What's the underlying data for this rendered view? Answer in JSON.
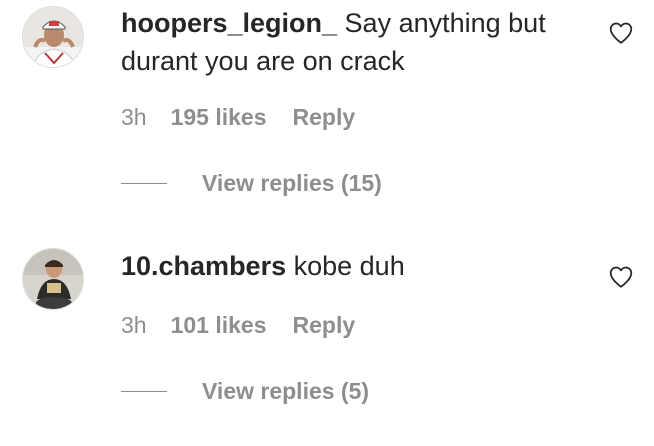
{
  "comments": [
    {
      "username": "hoopers_legion_",
      "text": " Say anything but durant you are on crack",
      "time": "3h",
      "likes": "195 likes",
      "reply_label": "Reply",
      "view_replies": "View replies (15)",
      "like_icon": "heart-outline-icon"
    },
    {
      "username": "10.chambers",
      "text": " kobe duh",
      "time": "3h",
      "likes": "101 likes",
      "reply_label": "Reply",
      "view_replies": "View replies (5)",
      "like_icon": "heart-outline-icon"
    }
  ],
  "colors": {
    "primary_text": "#262626",
    "secondary_text": "#8e8e8e",
    "background": "#ffffff"
  }
}
